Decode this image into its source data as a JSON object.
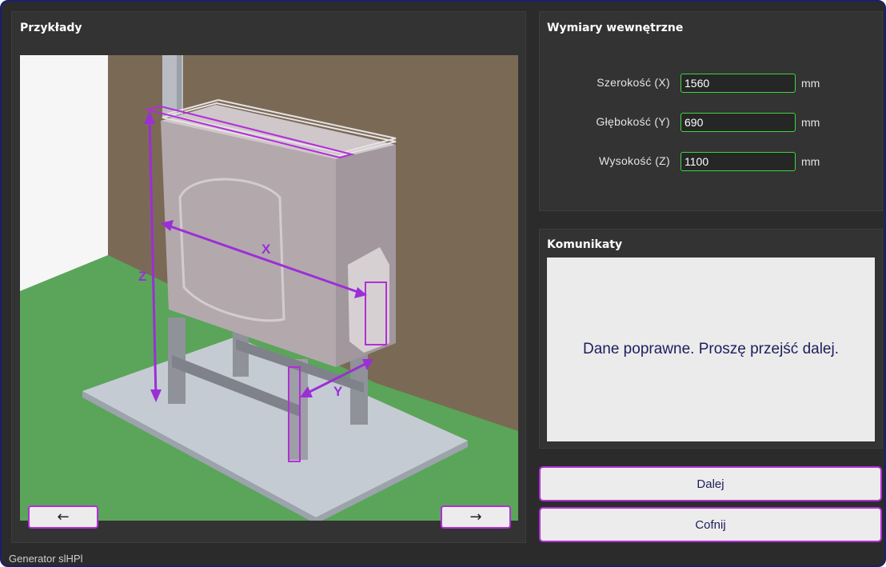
{
  "examples": {
    "title": "Przykłady",
    "prev_label": "←",
    "next_label": "→",
    "axis_x": "X",
    "axis_y": "Y",
    "axis_z": "Z"
  },
  "dimensions": {
    "title": "Wymiary wewnętrzne",
    "width_label": "Szerokość (X)",
    "width_value": "1560",
    "depth_label": "Głębokość (Y)",
    "depth_value": "690",
    "height_label": "Wysokość (Z)",
    "height_value": "1100",
    "unit": "mm"
  },
  "messages": {
    "title": "Komunikaty",
    "text": "Dane poprawne. Proszę przejść dalej."
  },
  "actions": {
    "next_label": "Dalej",
    "back_label": "Cofnij"
  },
  "footer": {
    "label": "Generator slHPl"
  },
  "colors": {
    "accent": "#b22fd6",
    "valid_border": "#3fd43f",
    "message_text": "#1c1f5c",
    "panel_bg": "#333333"
  }
}
